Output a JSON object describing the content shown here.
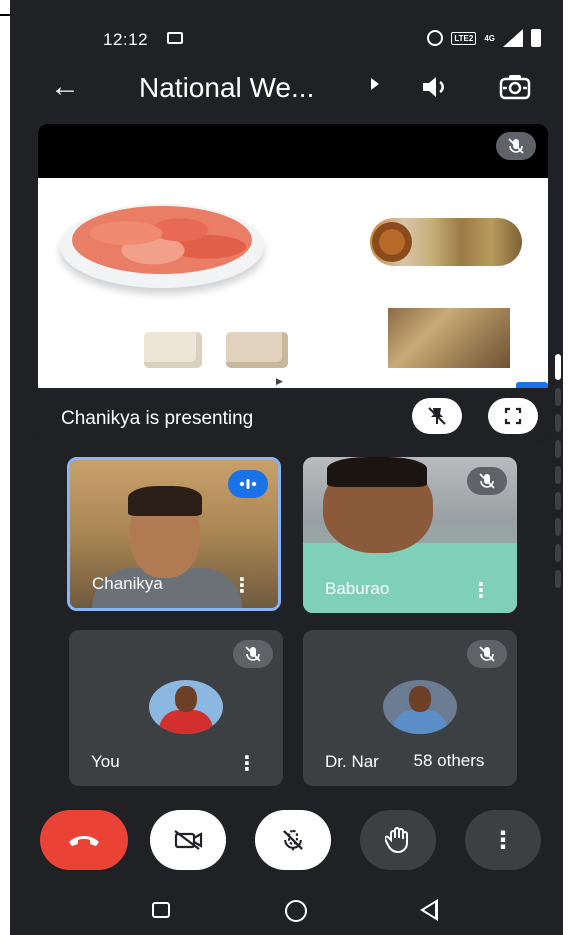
{
  "status_bar": {
    "time": "12:12",
    "icons": [
      "cast-icon",
      "alarm-icon",
      "volte-icon",
      "signal-4g-icon",
      "battery-icon"
    ],
    "volte_text": "LTE2",
    "network_text": "4G"
  },
  "header": {
    "title": "National We...",
    "icons": [
      "back-arrow-icon",
      "caret-right-icon",
      "speaker-icon",
      "switch-camera-icon"
    ]
  },
  "presentation": {
    "label": "Chanikya is presenting",
    "actions": [
      "unpin-icon",
      "fullscreen-icon"
    ]
  },
  "participants": [
    {
      "name": "Chanikya",
      "state": "speaking"
    },
    {
      "name": "Baburao",
      "state": "muted"
    },
    {
      "name": "You",
      "state": "muted"
    },
    {
      "name": "Dr. Nar",
      "state": "muted"
    }
  ],
  "others_label": "58 others",
  "controls": [
    "end-call-icon",
    "camera-off-icon",
    "mic-off-icon",
    "raise-hand-icon",
    "more-options-icon"
  ],
  "nav": [
    "recent-apps-icon",
    "home-icon",
    "back-icon"
  ],
  "colors": {
    "background": "#202124",
    "tile": "#3c4043",
    "end_call": "#ea4335",
    "accent": "#8ab4f8"
  }
}
